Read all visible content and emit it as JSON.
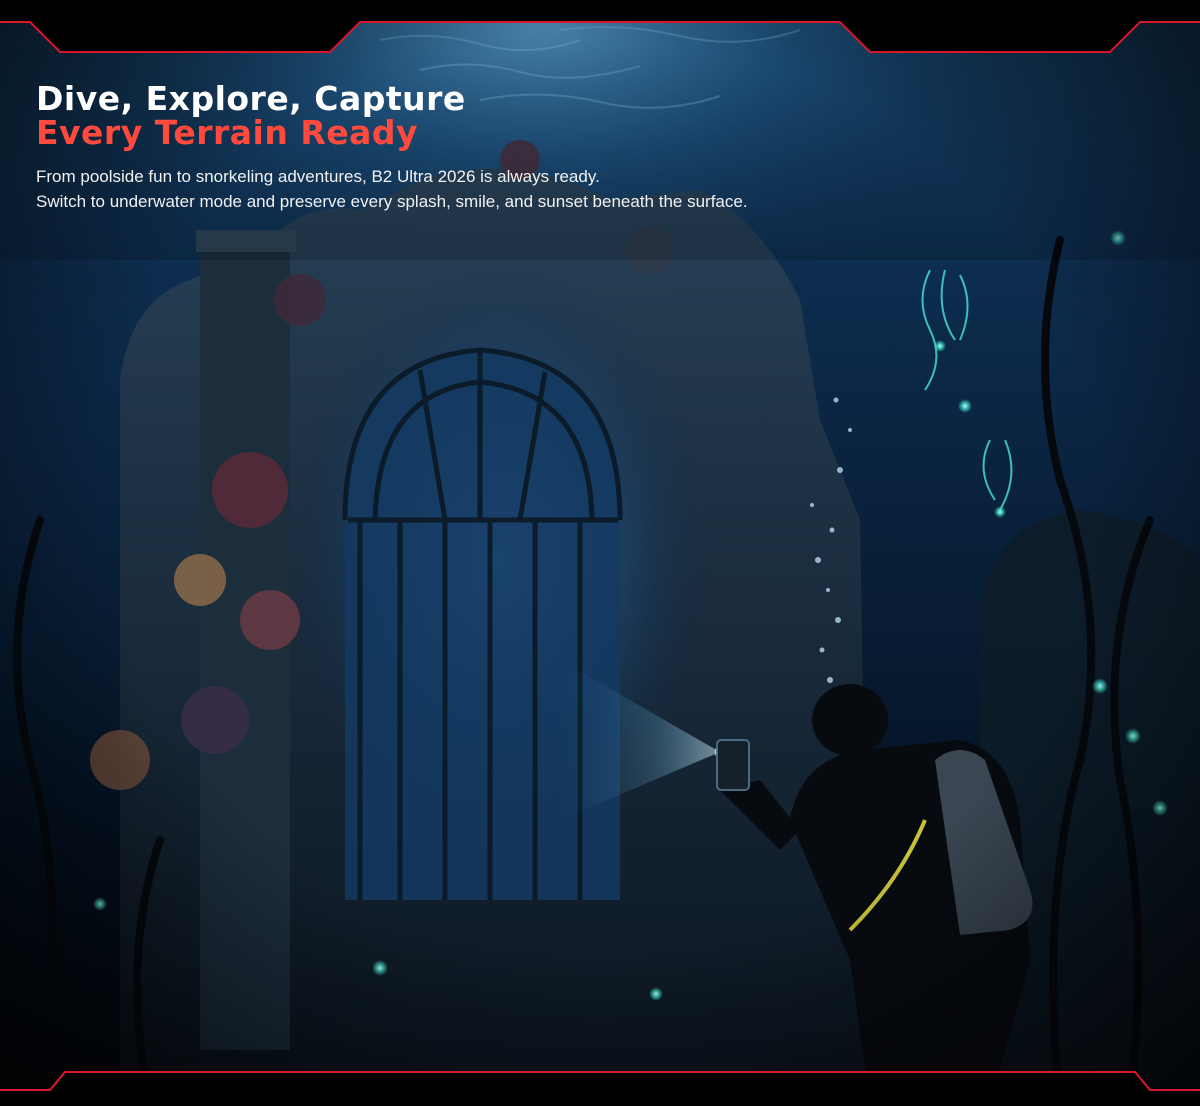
{
  "hero": {
    "headline_line1": "Dive, Explore, Capture",
    "headline_line2": "Every Terrain Ready",
    "description_line1": "From poolside fun to snorkeling adventures, B2 Ultra 2026 is always ready.",
    "description_line2": "Switch to underwater mode and preserve every splash, smile, and sunset beneath the surface."
  },
  "colors": {
    "headline_primary": "#ffffff",
    "headline_accent": "#ff4a3d",
    "frame_accent": "#d8182a",
    "water_deep": "#040a16",
    "water_mid": "#0c2a4a",
    "glow": "#48e6d2"
  }
}
